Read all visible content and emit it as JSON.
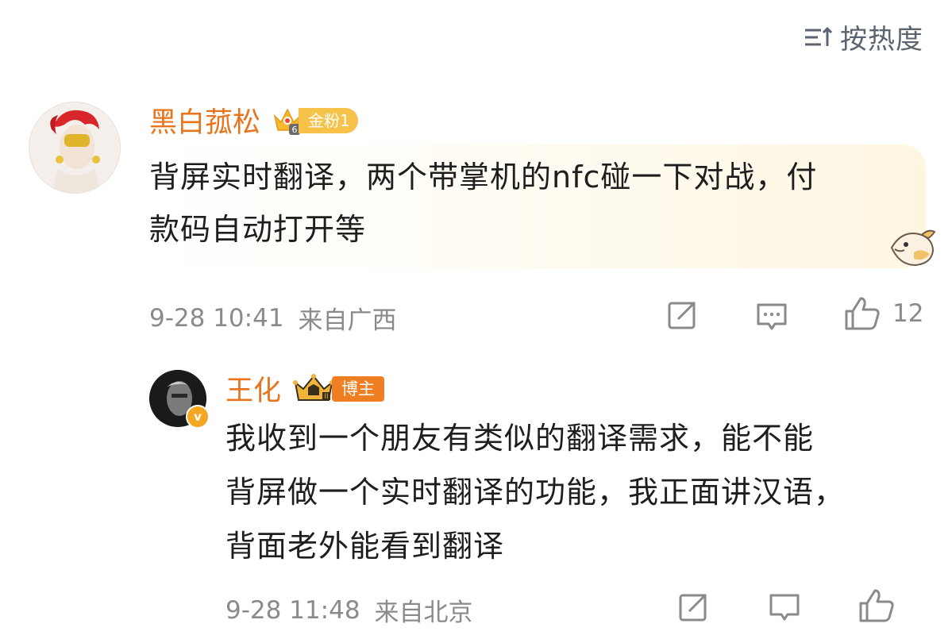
{
  "sort": {
    "label": "按热度"
  },
  "comments": [
    {
      "username": "黑白菰松",
      "badge": "金粉1",
      "text_lines": [
        "背屏实时翻译，两个带掌机的nfc碰一下对战，付",
        "款码自动打开等"
      ],
      "time": "9-28 10:41",
      "location": "来自广西",
      "likes": "12"
    }
  ],
  "reply": {
    "username": "王化",
    "badge": "博主",
    "verified_mark": "v",
    "text_lines": [
      "我收到一个朋友有类似的翻译需求，能不能",
      "背屏做一个实时翻译的功能，我正面讲汉语，",
      "背面老外能看到翻译"
    ],
    "time": "9-28 11:48",
    "location": "来自北京"
  },
  "colors": {
    "username": "#e8741e",
    "meta": "#8a8a8a",
    "text": "#1e1e1e",
    "badge_gold": "#f6c24a",
    "badge_orange": "#ef7f22"
  },
  "icons": [
    "sort-icon",
    "crown-gold-icon",
    "share-icon",
    "comment-icon",
    "like-icon",
    "fish-sticker-icon",
    "crown-vip-icon"
  ]
}
